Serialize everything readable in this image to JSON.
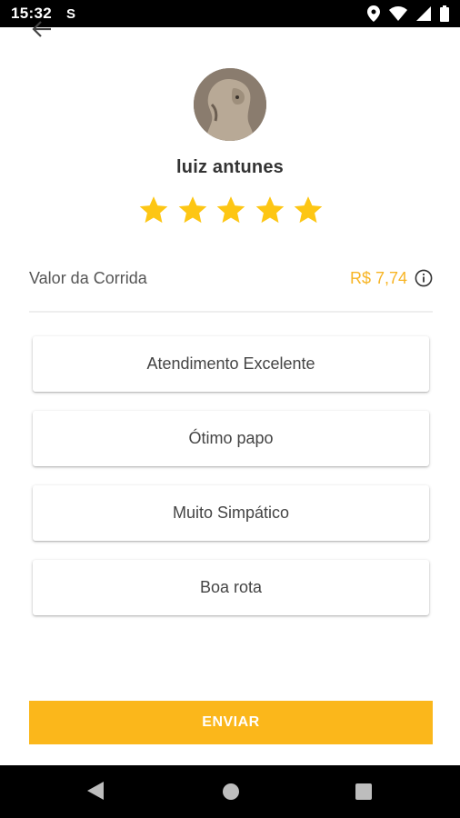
{
  "status_bar": {
    "time": "15:32",
    "notification_glyph": "S",
    "icons": [
      "location-icon",
      "wifi-icon",
      "signal-icon",
      "battery-icon"
    ]
  },
  "header": {
    "back_icon": "arrow-left-icon"
  },
  "driver": {
    "name": "luiz antunes",
    "rating": 5,
    "max_rating": 5
  },
  "fare": {
    "label": "Valor da Corrida",
    "value": "R$ 7,74",
    "info_icon": "info-icon"
  },
  "options": [
    {
      "label": "Atendimento Excelente"
    },
    {
      "label": "Ótimo papo"
    },
    {
      "label": "Muito Simpático"
    },
    {
      "label": "Boa rota"
    }
  ],
  "submit": {
    "label": "ENVIAR"
  },
  "colors": {
    "accent": "#fbb71b",
    "star": "#fdc614",
    "fare_value": "#f7b424"
  },
  "nav_bar": {
    "icons": [
      "nav-back-icon",
      "nav-home-icon",
      "nav-recents-icon"
    ]
  }
}
